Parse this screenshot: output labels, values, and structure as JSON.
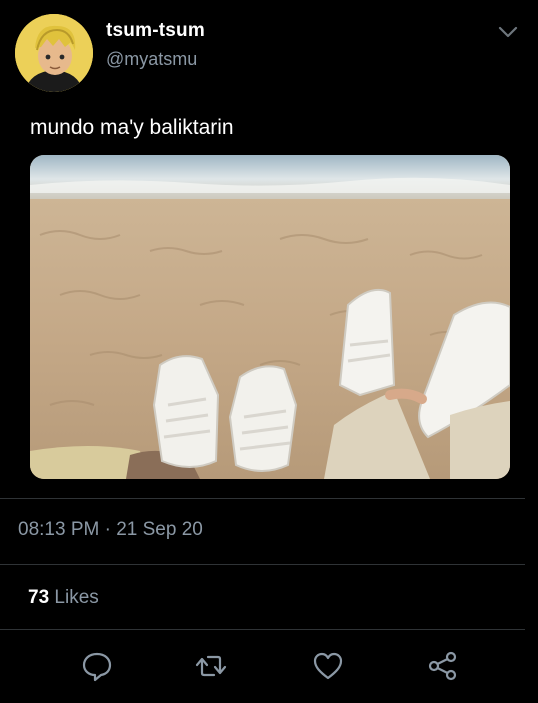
{
  "header": {
    "display_name": "tsum-tsum",
    "handle": "@myatsmu",
    "menu_icon": "chevron-down-icon"
  },
  "tweet": {
    "text": "mundo ma'y baliktarin",
    "media_description": "photo-beach-sneakers"
  },
  "meta": {
    "timestamp": "08:13 PM · 21 Sep 20"
  },
  "stats": {
    "likes_count": "73",
    "likes_label": "Likes"
  },
  "actions": [
    {
      "icon": "reply-icon"
    },
    {
      "icon": "retweet-icon"
    },
    {
      "icon": "like-icon"
    },
    {
      "icon": "share-icon"
    }
  ],
  "colors": {
    "background": "#000000",
    "primary_text": "#ffffff",
    "secondary_text": "#8b98a5",
    "divider": "#2f3336"
  }
}
